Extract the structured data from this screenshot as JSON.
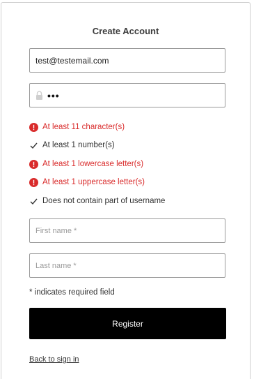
{
  "form": {
    "title": "Create Account",
    "email_value": "test@testemail.com",
    "password_mask": "•••",
    "first_name_placeholder": "First name *",
    "last_name_placeholder": "Last name *",
    "required_note": "* indicates required field",
    "register_label": "Register",
    "back_link": "Back to sign in"
  },
  "rules": [
    {
      "text": "At least 11 character(s)",
      "status": "error"
    },
    {
      "text": "At least 1 number(s)",
      "status": "ok"
    },
    {
      "text": "At least 1 lowercase letter(s)",
      "status": "error"
    },
    {
      "text": "At least 1 uppercase letter(s)",
      "status": "error"
    },
    {
      "text": "Does not contain part of username",
      "status": "ok"
    }
  ],
  "colors": {
    "error": "#d92b2b",
    "button": "#000000"
  },
  "icons": {
    "error": "error-circle-icon",
    "ok": "checkmark-icon",
    "password": "lock-icon"
  }
}
